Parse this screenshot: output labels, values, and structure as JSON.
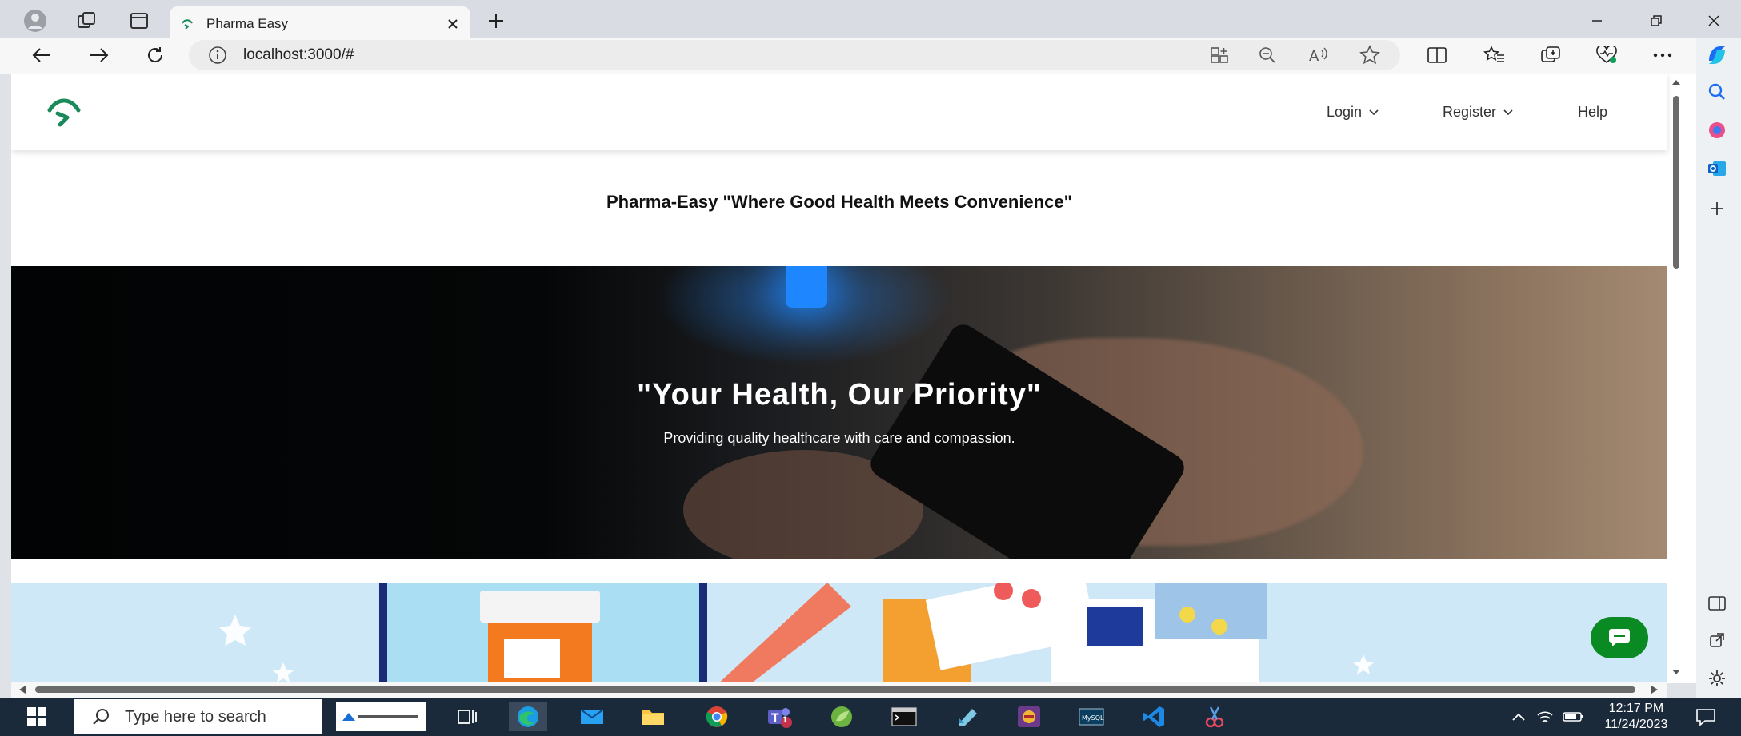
{
  "browser": {
    "tab_title": "Pharma Easy",
    "url": "localhost:3000/#"
  },
  "site": {
    "nav": {
      "login": "Login",
      "register": "Register",
      "help": "Help"
    },
    "tagline": "Pharma-Easy \"Where Good Health Meets Convenience\"",
    "hero": {
      "heading": "\"Your Health, Our Priority\"",
      "subheading": "Providing quality healthcare with care and compassion."
    }
  },
  "taskbar": {
    "search_placeholder": "Type here to search",
    "time": "12:17 PM",
    "date": "11/24/2023",
    "teams_badge": "1"
  },
  "colors": {
    "brand_green": "#0a8a22",
    "logo_green": "#1a8a5a"
  }
}
